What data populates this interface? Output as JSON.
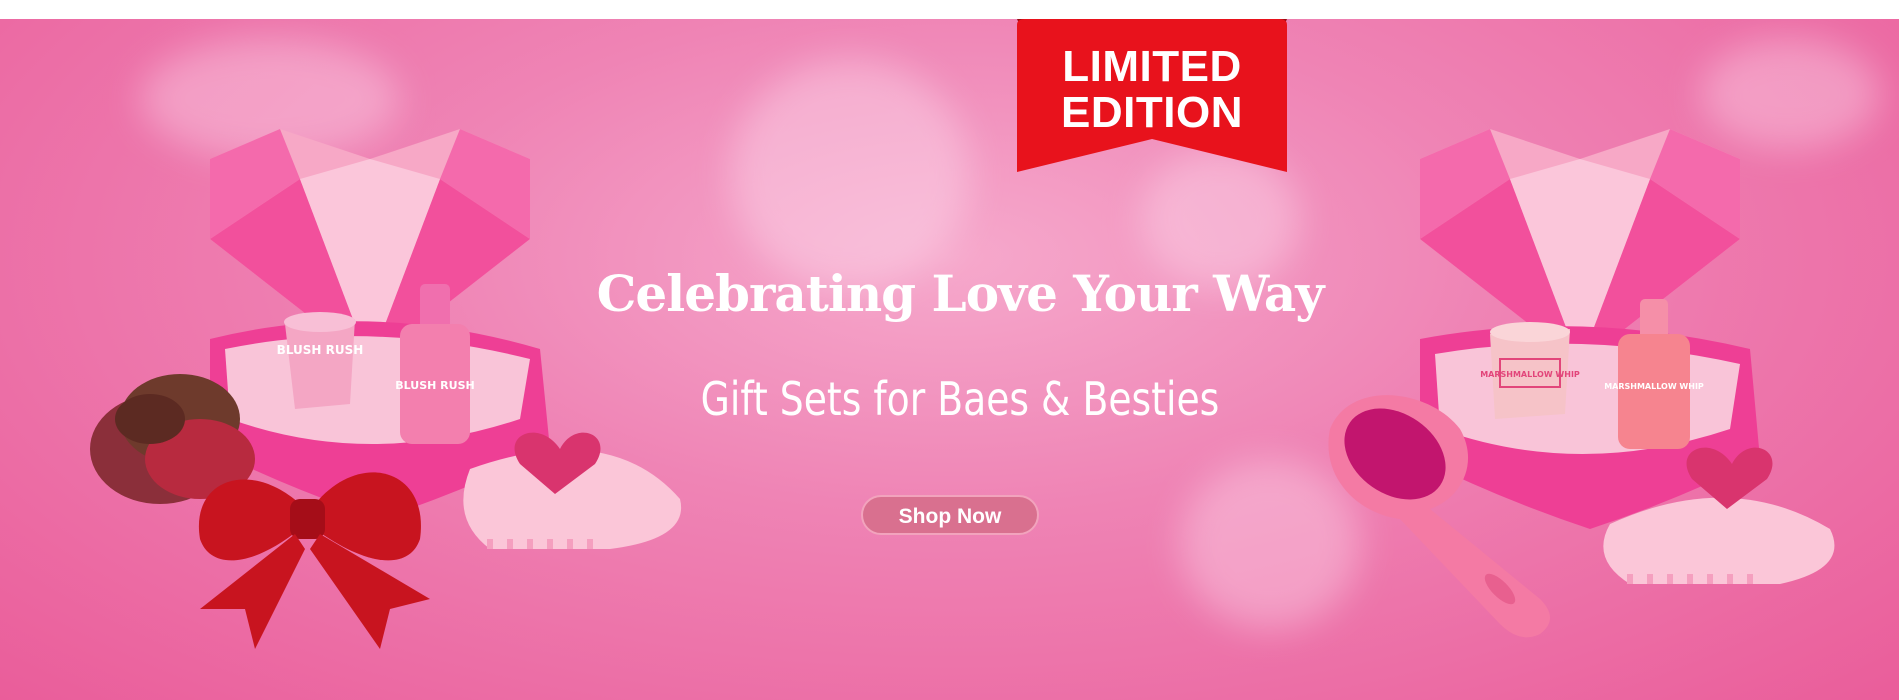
{
  "badge": {
    "line1": "LIMITED",
    "line2": "EDITION"
  },
  "headline": "Celebrating Love Your Way",
  "subheadline": "Gift Sets for Baes & Besties",
  "cta": {
    "label": "Shop Now"
  },
  "products": {
    "left_jar": "BLUSH RUSH",
    "left_bottle": "BLUSH RUSH",
    "right_jar": "MARSHMALLOW WHIP",
    "right_bottle": "MARSHMALLOW WHIP"
  },
  "colors": {
    "background": "#ef84b5",
    "badge": "#e8121c",
    "button": "#d9708f",
    "box": "#ee3f95"
  }
}
